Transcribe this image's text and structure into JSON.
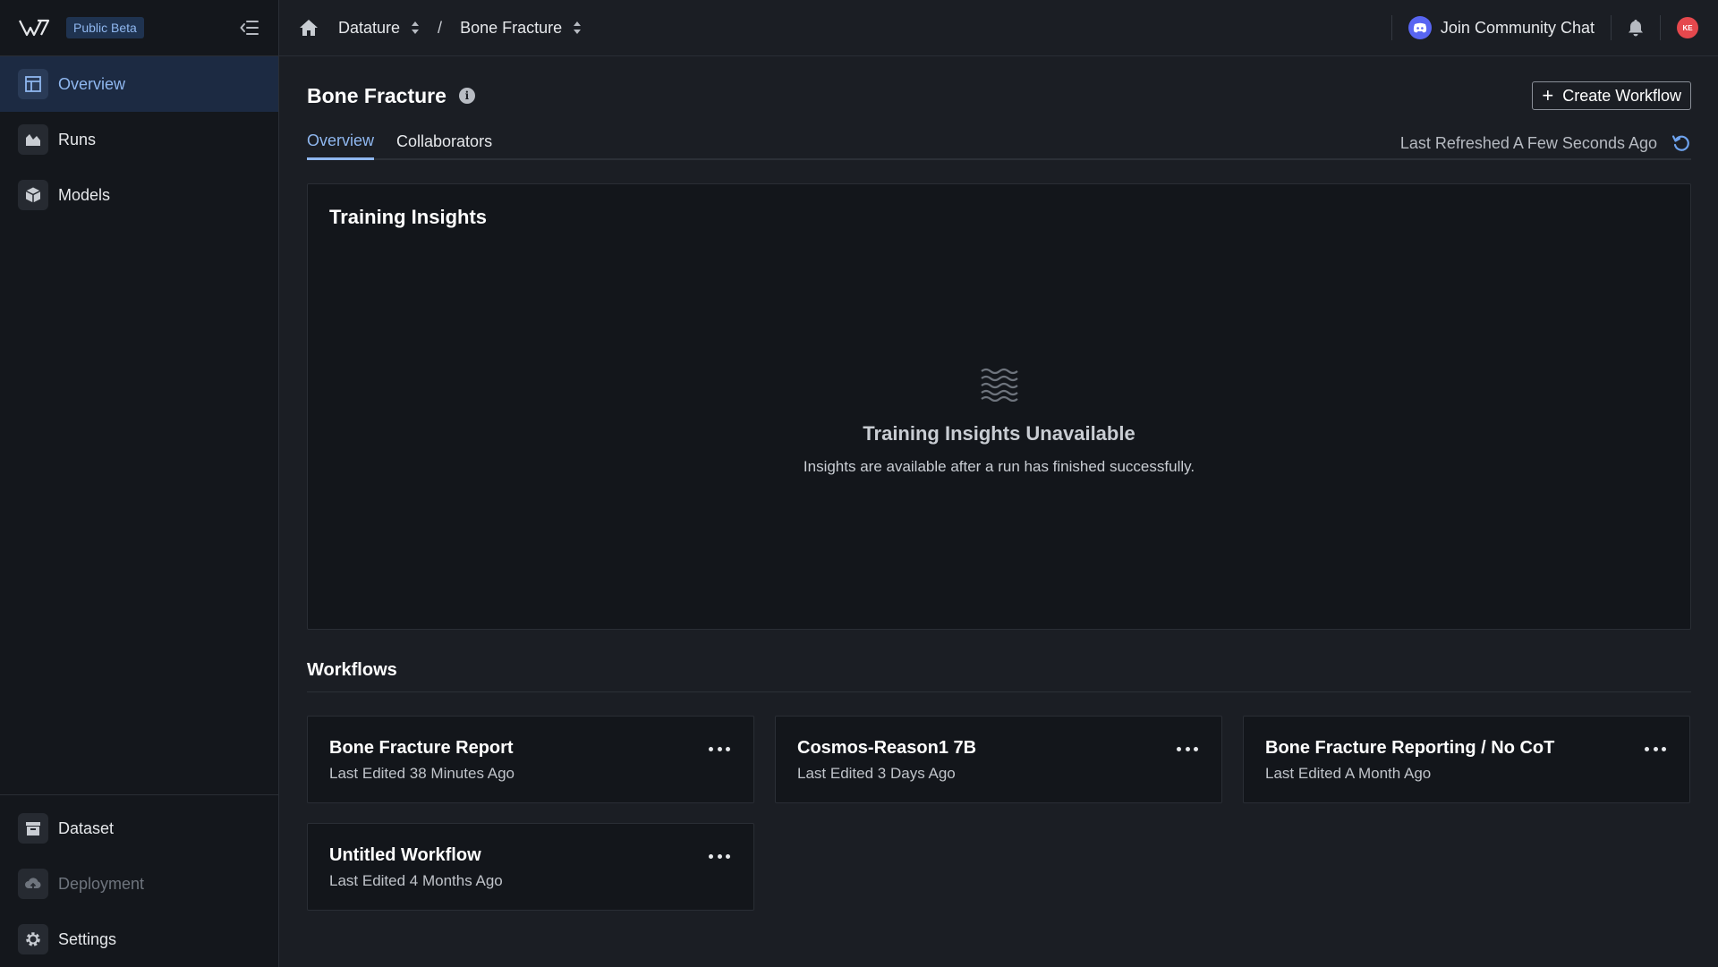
{
  "app": {
    "badge": "Public Beta"
  },
  "sidebar": {
    "items": [
      {
        "label": "Overview",
        "icon": "layout-icon",
        "active": true
      },
      {
        "label": "Runs",
        "icon": "chart-area-icon"
      },
      {
        "label": "Models",
        "icon": "cube-icon"
      }
    ],
    "bottom_items": [
      {
        "label": "Dataset",
        "icon": "archive-icon"
      },
      {
        "label": "Deployment",
        "icon": "cloud-upload-icon",
        "disabled": true
      },
      {
        "label": "Settings",
        "icon": "gear-icon"
      }
    ]
  },
  "topbar": {
    "breadcrumb": [
      "Datature",
      "Bone Fracture"
    ],
    "separator": "/",
    "community_label": "Join Community Chat",
    "avatar_initials": "KE"
  },
  "main": {
    "title": "Bone Fracture",
    "create_button": "Create Workflow",
    "tabs": [
      {
        "label": "Overview",
        "active": true
      },
      {
        "label": "Collaborators"
      }
    ],
    "last_refreshed": "Last Refreshed A Few Seconds Ago",
    "insights": {
      "title": "Training Insights",
      "empty_title": "Training Insights Unavailable",
      "empty_subtitle": "Insights are available after a run has finished successfully."
    },
    "workflows": {
      "heading": "Workflows",
      "items": [
        {
          "title": "Bone Fracture Report",
          "subtitle": "Last Edited 38 Minutes Ago"
        },
        {
          "title": "Cosmos-Reason1 7B",
          "subtitle": "Last Edited 3 Days Ago"
        },
        {
          "title": "Bone Fracture Reporting / No CoT",
          "subtitle": "Last Edited A Month Ago"
        },
        {
          "title": "Untitled Workflow",
          "subtitle": "Last Edited 4 Months Ago"
        }
      ]
    }
  },
  "colors": {
    "accent": "#8fb7ef",
    "background": "#1b1e24",
    "sidebar": "#14171c",
    "panel": "#13161b",
    "discord": "#5865f2",
    "avatar": "#e5484d"
  }
}
